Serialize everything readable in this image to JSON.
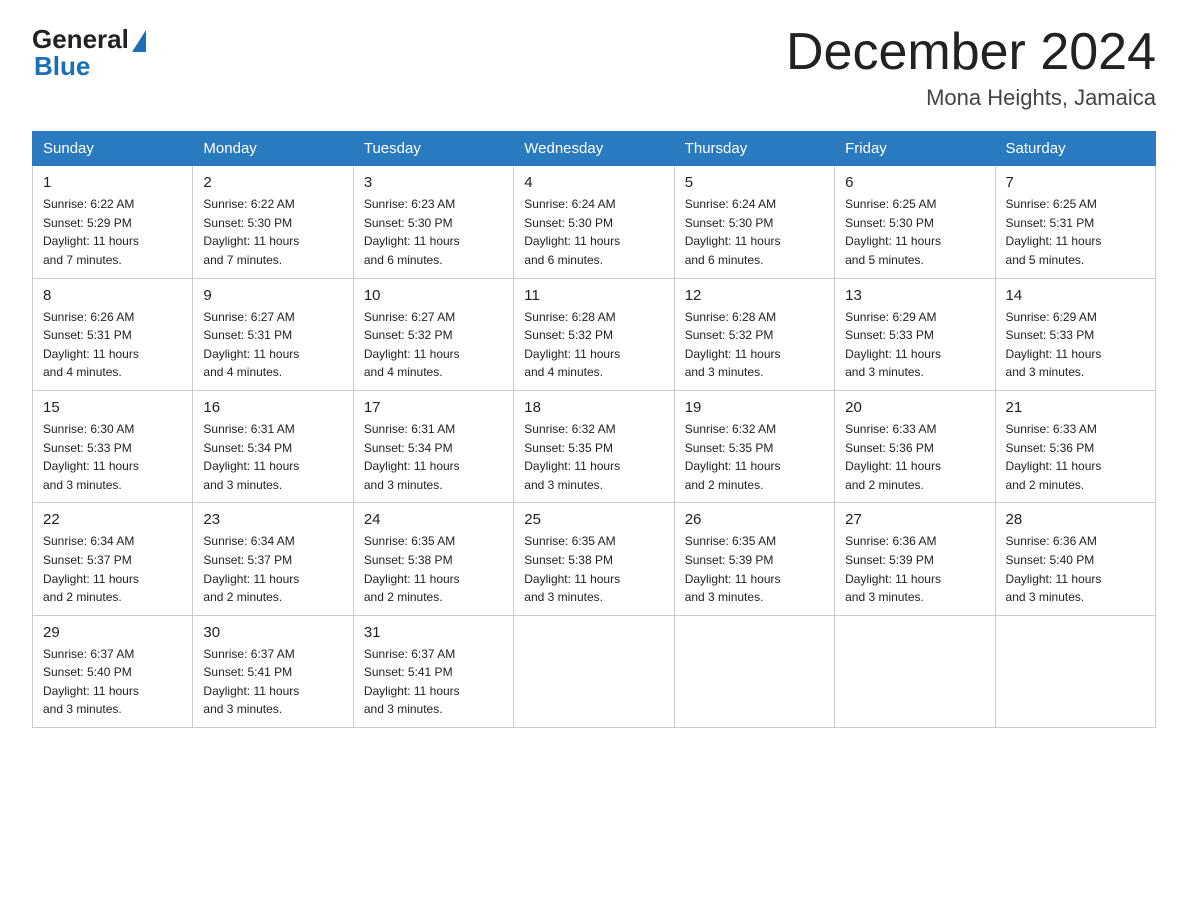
{
  "logo": {
    "general": "General",
    "blue": "Blue"
  },
  "header": {
    "month": "December 2024",
    "location": "Mona Heights, Jamaica"
  },
  "days_of_week": [
    "Sunday",
    "Monday",
    "Tuesday",
    "Wednesday",
    "Thursday",
    "Friday",
    "Saturday"
  ],
  "weeks": [
    [
      {
        "day": "1",
        "sunrise": "6:22 AM",
        "sunset": "5:29 PM",
        "daylight": "11 hours and 7 minutes."
      },
      {
        "day": "2",
        "sunrise": "6:22 AM",
        "sunset": "5:30 PM",
        "daylight": "11 hours and 7 minutes."
      },
      {
        "day": "3",
        "sunrise": "6:23 AM",
        "sunset": "5:30 PM",
        "daylight": "11 hours and 6 minutes."
      },
      {
        "day": "4",
        "sunrise": "6:24 AM",
        "sunset": "5:30 PM",
        "daylight": "11 hours and 6 minutes."
      },
      {
        "day": "5",
        "sunrise": "6:24 AM",
        "sunset": "5:30 PM",
        "daylight": "11 hours and 6 minutes."
      },
      {
        "day": "6",
        "sunrise": "6:25 AM",
        "sunset": "5:30 PM",
        "daylight": "11 hours and 5 minutes."
      },
      {
        "day": "7",
        "sunrise": "6:25 AM",
        "sunset": "5:31 PM",
        "daylight": "11 hours and 5 minutes."
      }
    ],
    [
      {
        "day": "8",
        "sunrise": "6:26 AM",
        "sunset": "5:31 PM",
        "daylight": "11 hours and 4 minutes."
      },
      {
        "day": "9",
        "sunrise": "6:27 AM",
        "sunset": "5:31 PM",
        "daylight": "11 hours and 4 minutes."
      },
      {
        "day": "10",
        "sunrise": "6:27 AM",
        "sunset": "5:32 PM",
        "daylight": "11 hours and 4 minutes."
      },
      {
        "day": "11",
        "sunrise": "6:28 AM",
        "sunset": "5:32 PM",
        "daylight": "11 hours and 4 minutes."
      },
      {
        "day": "12",
        "sunrise": "6:28 AM",
        "sunset": "5:32 PM",
        "daylight": "11 hours and 3 minutes."
      },
      {
        "day": "13",
        "sunrise": "6:29 AM",
        "sunset": "5:33 PM",
        "daylight": "11 hours and 3 minutes."
      },
      {
        "day": "14",
        "sunrise": "6:29 AM",
        "sunset": "5:33 PM",
        "daylight": "11 hours and 3 minutes."
      }
    ],
    [
      {
        "day": "15",
        "sunrise": "6:30 AM",
        "sunset": "5:33 PM",
        "daylight": "11 hours and 3 minutes."
      },
      {
        "day": "16",
        "sunrise": "6:31 AM",
        "sunset": "5:34 PM",
        "daylight": "11 hours and 3 minutes."
      },
      {
        "day": "17",
        "sunrise": "6:31 AM",
        "sunset": "5:34 PM",
        "daylight": "11 hours and 3 minutes."
      },
      {
        "day": "18",
        "sunrise": "6:32 AM",
        "sunset": "5:35 PM",
        "daylight": "11 hours and 3 minutes."
      },
      {
        "day": "19",
        "sunrise": "6:32 AM",
        "sunset": "5:35 PM",
        "daylight": "11 hours and 2 minutes."
      },
      {
        "day": "20",
        "sunrise": "6:33 AM",
        "sunset": "5:36 PM",
        "daylight": "11 hours and 2 minutes."
      },
      {
        "day": "21",
        "sunrise": "6:33 AM",
        "sunset": "5:36 PM",
        "daylight": "11 hours and 2 minutes."
      }
    ],
    [
      {
        "day": "22",
        "sunrise": "6:34 AM",
        "sunset": "5:37 PM",
        "daylight": "11 hours and 2 minutes."
      },
      {
        "day": "23",
        "sunrise": "6:34 AM",
        "sunset": "5:37 PM",
        "daylight": "11 hours and 2 minutes."
      },
      {
        "day": "24",
        "sunrise": "6:35 AM",
        "sunset": "5:38 PM",
        "daylight": "11 hours and 2 minutes."
      },
      {
        "day": "25",
        "sunrise": "6:35 AM",
        "sunset": "5:38 PM",
        "daylight": "11 hours and 3 minutes."
      },
      {
        "day": "26",
        "sunrise": "6:35 AM",
        "sunset": "5:39 PM",
        "daylight": "11 hours and 3 minutes."
      },
      {
        "day": "27",
        "sunrise": "6:36 AM",
        "sunset": "5:39 PM",
        "daylight": "11 hours and 3 minutes."
      },
      {
        "day": "28",
        "sunrise": "6:36 AM",
        "sunset": "5:40 PM",
        "daylight": "11 hours and 3 minutes."
      }
    ],
    [
      {
        "day": "29",
        "sunrise": "6:37 AM",
        "sunset": "5:40 PM",
        "daylight": "11 hours and 3 minutes."
      },
      {
        "day": "30",
        "sunrise": "6:37 AM",
        "sunset": "5:41 PM",
        "daylight": "11 hours and 3 minutes."
      },
      {
        "day": "31",
        "sunrise": "6:37 AM",
        "sunset": "5:41 PM",
        "daylight": "11 hours and 3 minutes."
      },
      null,
      null,
      null,
      null
    ]
  ],
  "labels": {
    "sunrise": "Sunrise:",
    "sunset": "Sunset:",
    "daylight": "Daylight:"
  }
}
